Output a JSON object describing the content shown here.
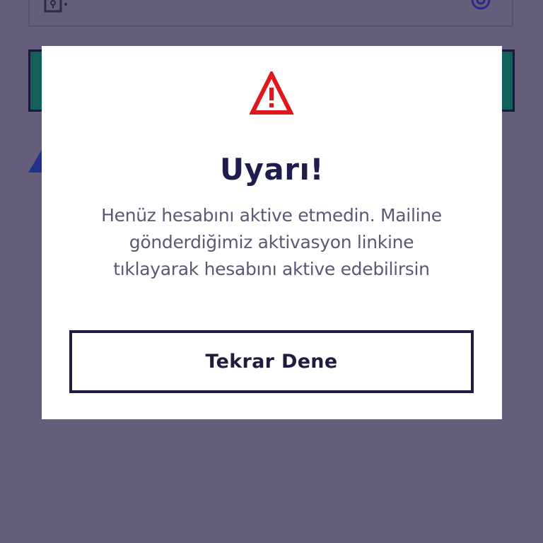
{
  "background": {
    "overlay_color": "#655e7a",
    "password_field_icons": [
      "lock-icon",
      "eye-icon"
    ],
    "primary_button_color": "#135f5a"
  },
  "alert": {
    "icon": "warning-triangle-icon",
    "icon_color": "#e1161c",
    "title": "Uyarı!",
    "message": "Henüz hesabını aktive etmedin. Mailine gönderdiğimiz aktivasyon linkine tıklayarak hesabını aktive edebilirsin",
    "retry_button_label": "Tekrar Dene",
    "title_color": "#1f1d4d"
  }
}
